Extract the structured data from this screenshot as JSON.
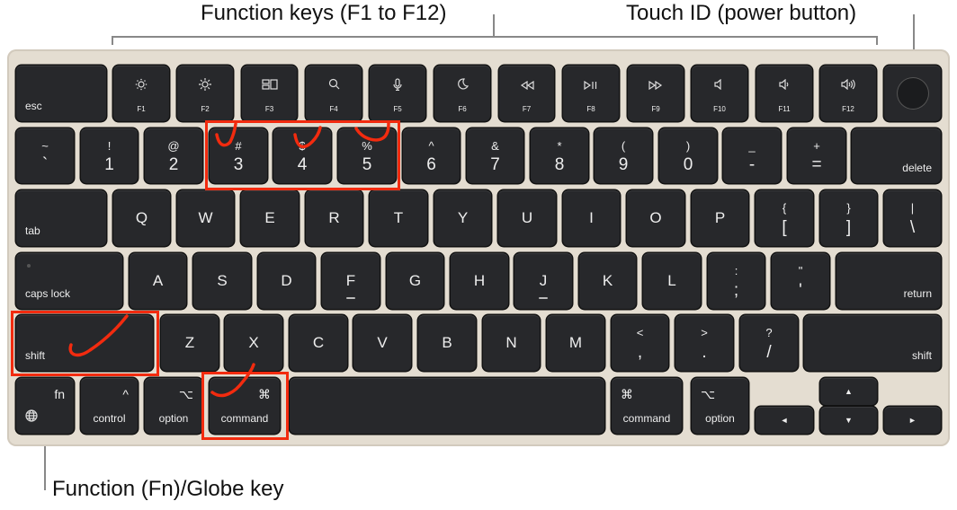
{
  "callouts": {
    "function_keys": "Function keys (F1 to F12)",
    "touch_id": "Touch ID (power button)",
    "fn_globe": "Function (Fn)/Globe key"
  },
  "colors": {
    "keyboard_body": "#e4ddd1",
    "key": "#27282b",
    "annotation": "#f22b0f"
  },
  "rows": [
    [
      {
        "type": "mod",
        "bl": "esc"
      },
      {
        "type": "fn",
        "label": "F1",
        "icon": "brightness-down"
      },
      {
        "type": "fn",
        "label": "F2",
        "icon": "brightness-up"
      },
      {
        "type": "fn",
        "label": "F3",
        "icon": "mission-control"
      },
      {
        "type": "fn",
        "label": "F4",
        "icon": "search"
      },
      {
        "type": "fn",
        "label": "F5",
        "icon": "microphone"
      },
      {
        "type": "fn",
        "label": "F6",
        "icon": "moon"
      },
      {
        "type": "fn",
        "label": "F7",
        "icon": "rewind"
      },
      {
        "type": "fn",
        "label": "F8",
        "icon": "play-pause"
      },
      {
        "type": "fn",
        "label": "F9",
        "icon": "fast-forward"
      },
      {
        "type": "fn",
        "label": "F10",
        "icon": "mute"
      },
      {
        "type": "fn",
        "label": "F11",
        "icon": "volume-down"
      },
      {
        "type": "fn",
        "label": "F12",
        "icon": "volume-up"
      },
      {
        "type": "touchid",
        "name": "touch-id"
      }
    ],
    [
      {
        "type": "dual",
        "sym": "~",
        "num": "`"
      },
      {
        "type": "dual",
        "sym": "!",
        "num": "1"
      },
      {
        "type": "dual",
        "sym": "@",
        "num": "2"
      },
      {
        "type": "dual",
        "sym": "#",
        "num": "3"
      },
      {
        "type": "dual",
        "sym": "$",
        "num": "4"
      },
      {
        "type": "dual",
        "sym": "%",
        "num": "5"
      },
      {
        "type": "dual",
        "sym": "^",
        "num": "6"
      },
      {
        "type": "dual",
        "sym": "&",
        "num": "7"
      },
      {
        "type": "dual",
        "sym": "*",
        "num": "8"
      },
      {
        "type": "dual",
        "sym": "(",
        "num": "9"
      },
      {
        "type": "dual",
        "sym": ")",
        "num": "0"
      },
      {
        "type": "dual",
        "sym": "_",
        "num": "-"
      },
      {
        "type": "dual",
        "sym": "+",
        "num": "="
      },
      {
        "type": "mod",
        "br": "delete"
      }
    ],
    [
      {
        "type": "mod",
        "bl": "tab"
      },
      {
        "type": "letter",
        "l": "Q"
      },
      {
        "type": "letter",
        "l": "W"
      },
      {
        "type": "letter",
        "l": "E"
      },
      {
        "type": "letter",
        "l": "R"
      },
      {
        "type": "letter",
        "l": "T"
      },
      {
        "type": "letter",
        "l": "Y"
      },
      {
        "type": "letter",
        "l": "U"
      },
      {
        "type": "letter",
        "l": "I"
      },
      {
        "type": "letter",
        "l": "O"
      },
      {
        "type": "letter",
        "l": "P"
      },
      {
        "type": "dual",
        "sym": "{",
        "num": "["
      },
      {
        "type": "dual",
        "sym": "}",
        "num": "]"
      },
      {
        "type": "dual",
        "sym": "|",
        "num": "\\"
      }
    ],
    [
      {
        "type": "mod",
        "bl": "caps lock"
      },
      {
        "type": "letter",
        "l": "A"
      },
      {
        "type": "letter",
        "l": "S"
      },
      {
        "type": "letter",
        "l": "D"
      },
      {
        "type": "letter",
        "l": "F"
      },
      {
        "type": "letter",
        "l": "G"
      },
      {
        "type": "letter",
        "l": "H"
      },
      {
        "type": "letter",
        "l": "J"
      },
      {
        "type": "letter",
        "l": "K"
      },
      {
        "type": "letter",
        "l": "L"
      },
      {
        "type": "dual",
        "sym": ":",
        "num": ";"
      },
      {
        "type": "dual",
        "sym": "\"",
        "num": "'"
      },
      {
        "type": "mod",
        "br": "return"
      }
    ],
    [
      {
        "type": "mod",
        "bl": "shift"
      },
      {
        "type": "letter",
        "l": "Z"
      },
      {
        "type": "letter",
        "l": "X"
      },
      {
        "type": "letter",
        "l": "C"
      },
      {
        "type": "letter",
        "l": "V"
      },
      {
        "type": "letter",
        "l": "B"
      },
      {
        "type": "letter",
        "l": "N"
      },
      {
        "type": "letter",
        "l": "M"
      },
      {
        "type": "dual",
        "sym": "<",
        "num": ","
      },
      {
        "type": "dual",
        "sym": ">",
        "num": "."
      },
      {
        "type": "dual",
        "sym": "?",
        "num": "/"
      },
      {
        "type": "mod",
        "br": "shift"
      }
    ],
    [
      {
        "type": "fnkey",
        "tr": "fn",
        "icon": "globe"
      },
      {
        "type": "mod2",
        "top": "^",
        "mid": "control"
      },
      {
        "type": "mod2",
        "top": "⌥",
        "mid": "option"
      },
      {
        "type": "modr",
        "tr": "⌘",
        "mid": "command"
      },
      {
        "type": "space"
      },
      {
        "type": "modl",
        "tl": "⌘",
        "mid": "command"
      },
      {
        "type": "modl",
        "tl": "⌥",
        "mid": "option"
      },
      {
        "type": "arrow",
        "a": "◄",
        "name": "arrow-left"
      },
      {
        "type": "arrow",
        "a": "▲",
        "name": "arrow-up"
      },
      {
        "type": "arrow",
        "a": "▼",
        "name": "arrow-down"
      },
      {
        "type": "arrow",
        "a": "►",
        "name": "arrow-right"
      }
    ]
  ]
}
